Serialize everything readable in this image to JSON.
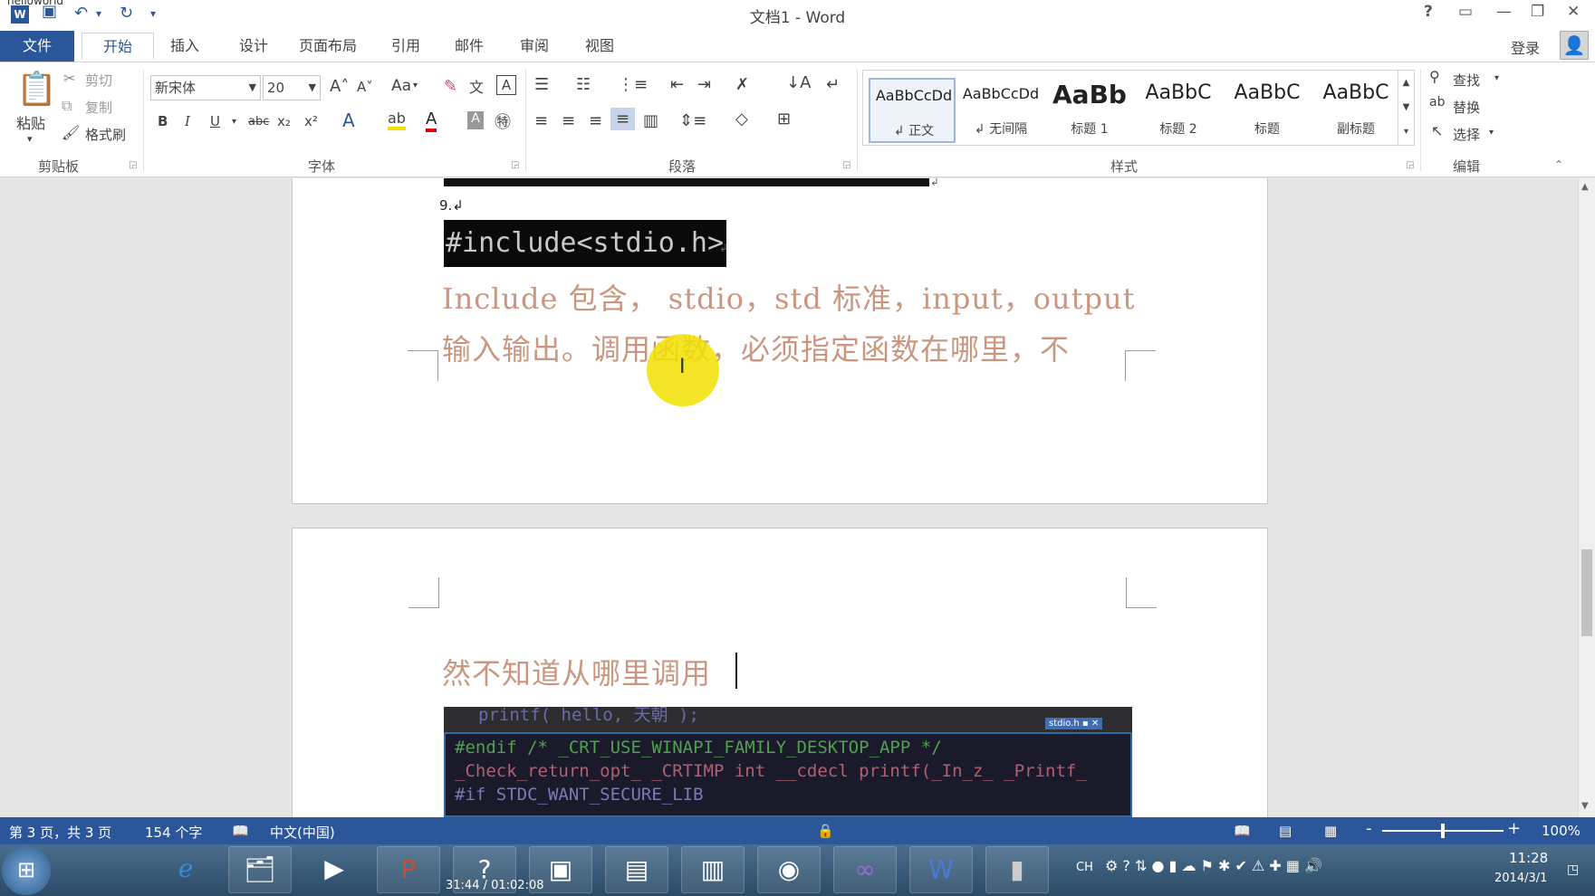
{
  "titlebar": {
    "app_tag": "helloworld",
    "title": "文档1 - Word",
    "help": "?",
    "qa_undo": "↶",
    "qa_redo": "↻",
    "qa_more": "▾"
  },
  "tabs": [
    "开始",
    "插入",
    "设计",
    "页面布局",
    "引用",
    "邮件",
    "审阅",
    "视图"
  ],
  "file_tab": "文件",
  "login": "登录",
  "clipboard": {
    "paste": "粘贴",
    "cut": "剪切",
    "copy": "复制",
    "format_painter": "格式刷",
    "label": "剪贴板"
  },
  "font": {
    "name": "新宋体",
    "size": "20",
    "label": "字体",
    "case": "Aa",
    "bold": "B",
    "italic": "I",
    "underline": "U",
    "strike": "abc",
    "sub": "x₂",
    "sup": "x²"
  },
  "paragraph": {
    "label": "段落"
  },
  "styles": {
    "label": "样式",
    "items": [
      {
        "preview": "AaBbCcDd",
        "name": "↲ 正文"
      },
      {
        "preview": "AaBbCcDd",
        "name": "↲ 无间隔"
      },
      {
        "preview": "AaBb",
        "name": "标题 1"
      },
      {
        "preview": "AaBbC",
        "name": "标题 2"
      },
      {
        "preview": "AaBbC",
        "name": "标题"
      },
      {
        "preview": "AaBbC",
        "name": "副标题"
      }
    ]
  },
  "editing": {
    "find": "查找",
    "replace": "替换",
    "select": "选择",
    "label": "编辑"
  },
  "document": {
    "item_number": "9.↲",
    "code": "#include<stdio.h>",
    "line1": "Include 包含， stdio，std 标准，input，output",
    "line2": "输入输出。调用函数，必须指定函数在哪里，不",
    "line3": "然不知道从哪里调用"
  },
  "vs_screenshot": {
    "tab": "stdio.h",
    "lines": [
      "printf( hello, 天朝 );",
      "#endif  /* _CRT_USE_WINAPI_FAMILY_DESKTOP_APP */",
      "_Check_return_opt_ _CRTIMP int __cdecl printf(_In_z_ _Printf_",
      "#if   STDC_WANT_SECURE_LIB"
    ]
  },
  "status": {
    "page": "第 3 页，共 3 页",
    "words": "154 个字",
    "language": "中文(中国)",
    "zoom": "100%",
    "zoom_minus": "-",
    "zoom_plus": "+",
    "zoom_level": 0.5
  },
  "taskbar": {
    "time_elapsed": "31:44 / 01:02:08",
    "ime": "CH",
    "clock_time": "11:28",
    "clock_date": "2014/3/1"
  },
  "colors": {
    "accent": "#2b579a",
    "doc_text": "#c9977f",
    "highlight": "#f2e200"
  }
}
